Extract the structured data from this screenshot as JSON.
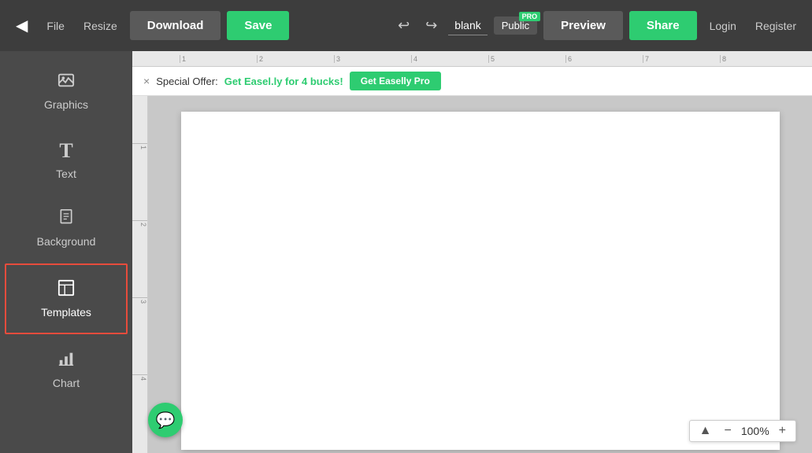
{
  "toolbar": {
    "back_icon": "◀",
    "file_label": "File",
    "resize_label": "Resize",
    "download_label": "Download",
    "save_label": "Save",
    "undo_icon": "↩",
    "redo_icon": "↪",
    "doc_name": "blank",
    "visibility_label": "Public",
    "pro_badge": "PRO",
    "preview_label": "Preview",
    "share_label": "Share",
    "login_label": "Login",
    "register_label": "Register"
  },
  "offer": {
    "close_icon": "×",
    "text": "Special Offer: ",
    "link_text": "Get Easel.ly for 4 bucks!",
    "button_label": "Get Easelly Pro"
  },
  "sidebar": {
    "items": [
      {
        "id": "graphics",
        "label": "Graphics",
        "icon": "🖼"
      },
      {
        "id": "text",
        "label": "Text",
        "icon": "T"
      },
      {
        "id": "background",
        "label": "Background",
        "icon": "📄"
      },
      {
        "id": "templates",
        "label": "Templates",
        "icon": "⊞",
        "active": true
      },
      {
        "id": "chart",
        "label": "Chart",
        "icon": "📊"
      }
    ]
  },
  "ruler": {
    "top_marks": [
      "1",
      "2",
      "3",
      "4",
      "5",
      "6",
      "7",
      "8"
    ],
    "left_marks": [
      "1",
      "2",
      "3",
      "4"
    ]
  },
  "zoom": {
    "up_icon": "▲",
    "minus_icon": "−",
    "value": "100%",
    "plus_icon": "+"
  },
  "chat": {
    "icon": "💬"
  }
}
